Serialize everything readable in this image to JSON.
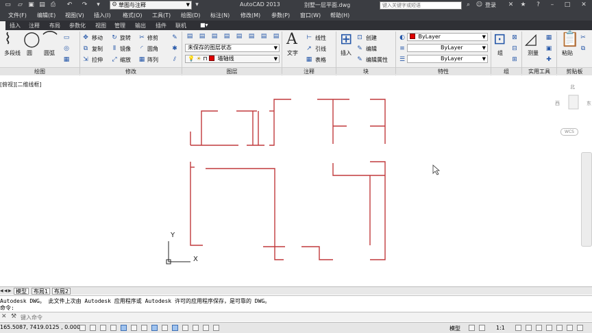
{
  "titlebar": {
    "workspace": "草图与注释",
    "app_title": "AutoCAD 2013",
    "doc_title": "别墅一层平面.dwg",
    "search_placeholder": "键入关键字或短语",
    "login": "登录"
  },
  "menubar": {
    "items": [
      "文件(F)",
      "编辑(E)",
      "视图(V)",
      "插入(I)",
      "格式(O)",
      "工具(T)",
      "绘图(D)",
      "标注(N)",
      "修改(M)",
      "参数(P)",
      "窗口(W)",
      "帮助(H)"
    ]
  },
  "ribbon_tabs": [
    "插入",
    "注释",
    "布局",
    "参数化",
    "视图",
    "管理",
    "输出",
    "插件",
    "联机"
  ],
  "ribbon": {
    "draw": {
      "polyline": "多段线",
      "circle": "圆",
      "arc": "圆弧",
      "label": "绘图"
    },
    "modify": {
      "move": "移动",
      "rotate": "旋转",
      "trim": "修剪",
      "copy": "复制",
      "mirror": "镜像",
      "fillet": "圆角",
      "stretch": "拉伸",
      "scale": "缩放",
      "array": "阵列",
      "label": "修改"
    },
    "layers": {
      "state": "未保存的图层状态",
      "current": "墙轴线",
      "label": "图层"
    },
    "annotation": {
      "text": "文字",
      "linear": "线性",
      "leader": "引线",
      "table": "表格",
      "label": "注释"
    },
    "block": {
      "insert": "插入",
      "create": "创建",
      "edit": "编辑",
      "edit_attr": "编辑属性",
      "label": "块"
    },
    "properties": {
      "color": "ByLayer",
      "linetype": "ByLayer",
      "lineweight": "ByLayer",
      "label": "特性"
    },
    "groups": {
      "group": "组",
      "label": "组"
    },
    "utilities": {
      "measure": "测量",
      "label": "实用工具"
    },
    "clipboard": {
      "paste": "粘贴",
      "label": "剪贴板"
    }
  },
  "canvas": {
    "viewport_label": "[俯视][二维线框]",
    "compass": {
      "north": "北",
      "west": "西",
      "east": "东",
      "wcs": "WCS"
    },
    "ucs": {
      "x": "X",
      "y": "Y"
    }
  },
  "layout_tabs": [
    "模型",
    "布局1",
    "布局2"
  ],
  "command": {
    "history_1": "Autodesk DWG。  此文件上次由 Autodesk 应用程序或 Autodesk 许可的应用程序保存，是可靠的 DWG。",
    "history_2": "命令:",
    "placeholder": "键入命令"
  },
  "status": {
    "coords": "165.5087, 7419.0125 , 0.0000",
    "model": "模型",
    "scale": "1:1"
  },
  "colors": {
    "wall": "#c0393b",
    "titlebar": "#3b3d42",
    "ribbon": "#f0f0f0"
  }
}
